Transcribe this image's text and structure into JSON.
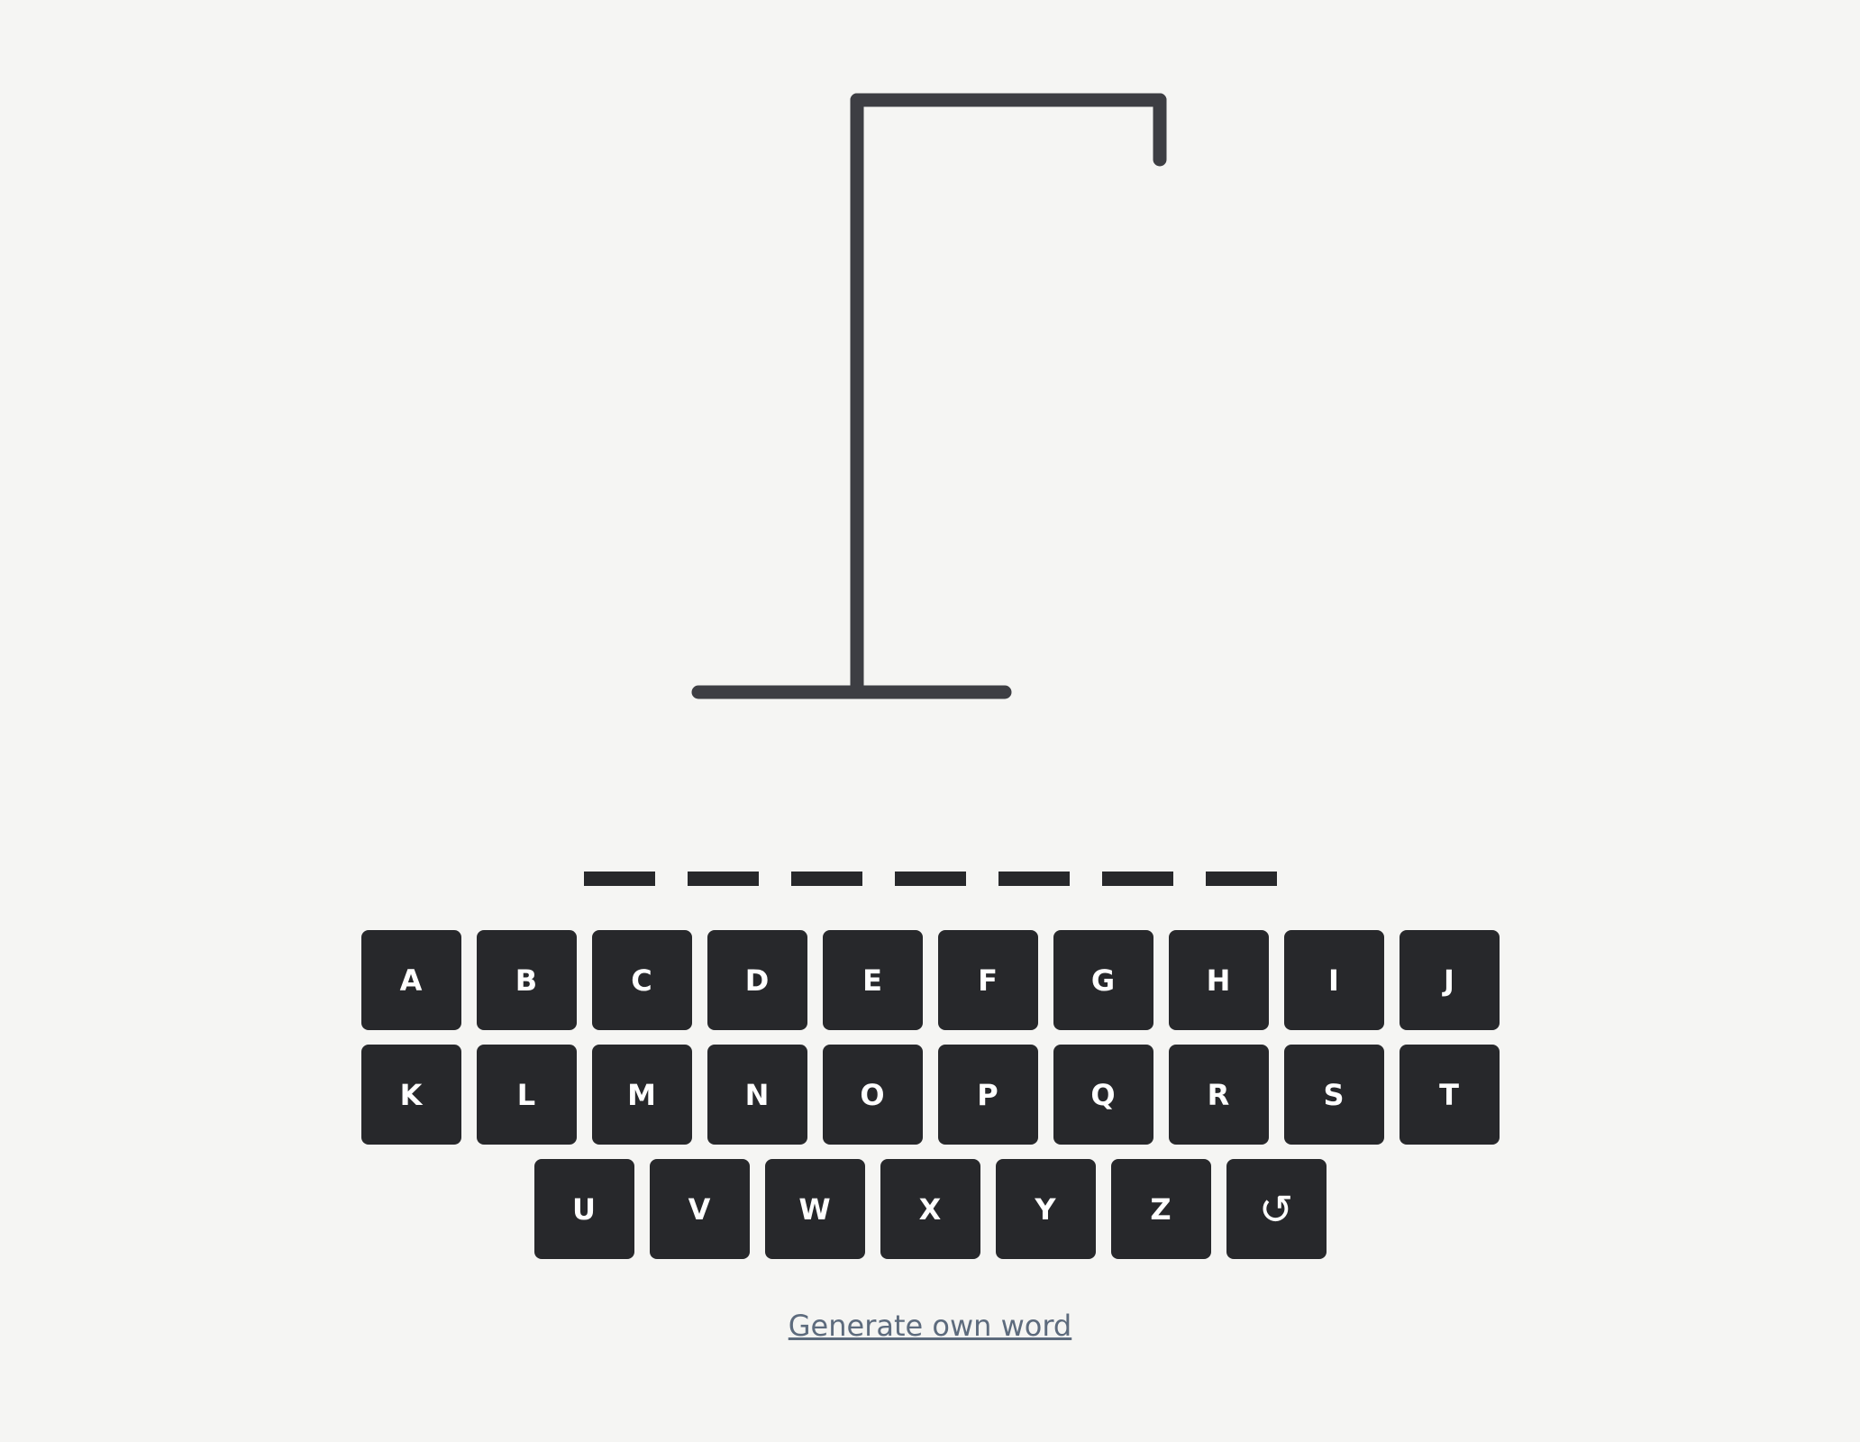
{
  "game": {
    "word_length": 7,
    "wrong_guesses": 0
  },
  "keyboard": {
    "rows": [
      [
        "A",
        "B",
        "C",
        "D",
        "E",
        "F",
        "G",
        "H",
        "I",
        "J"
      ],
      [
        "K",
        "L",
        "M",
        "N",
        "O",
        "P",
        "Q",
        "R",
        "S",
        "T"
      ],
      [
        "U",
        "V",
        "W",
        "X",
        "Y",
        "Z"
      ]
    ],
    "reset_label": "↺"
  },
  "links": {
    "own_word_label": "Generate own word"
  },
  "colors": {
    "background": "#f5f5f3",
    "gallows": "#3d3e43",
    "key_background": "#27282b",
    "key_text": "#ffffff",
    "link": "#5d6b7d"
  }
}
